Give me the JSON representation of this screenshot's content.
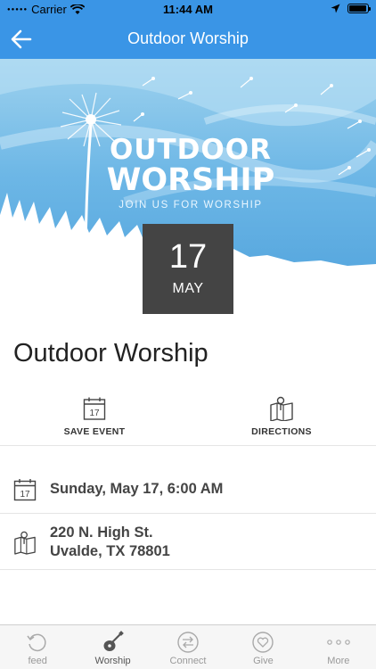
{
  "status_bar": {
    "carrier": "Carrier",
    "time": "11:44 AM"
  },
  "nav": {
    "title": "Outdoor Worship",
    "back_icon": "arrow-left-icon"
  },
  "hero": {
    "line1": "OUTDOOR",
    "line2": "WORSHIP",
    "line3": "JOIN US FOR WORSHIP"
  },
  "date": {
    "day": "17",
    "month": "MAY"
  },
  "event": {
    "title": "Outdoor Worship"
  },
  "actions": [
    {
      "label": "SAVE EVENT",
      "icon": "calendar-icon",
      "calendar_day": "17"
    },
    {
      "label": "DIRECTIONS",
      "icon": "map-pin-icon"
    }
  ],
  "details": {
    "datetime": "Sunday, May 17, 6:00 AM",
    "calendar_day": "17",
    "address_line1": "220 N. High St.",
    "address_line2": "Uvalde, TX 78801"
  },
  "tabs": [
    {
      "label": "feed",
      "icon": "feed-icon"
    },
    {
      "label": "Worship",
      "icon": "guitar-icon",
      "active": true
    },
    {
      "label": "Connect",
      "icon": "connect-arrows-icon"
    },
    {
      "label": "Give",
      "icon": "heart-icon"
    },
    {
      "label": "More",
      "icon": "more-dots-icon"
    }
  ],
  "colors": {
    "accent": "#3a95e6",
    "date_box": "#444444",
    "hero_sky": "#6db7e6"
  }
}
